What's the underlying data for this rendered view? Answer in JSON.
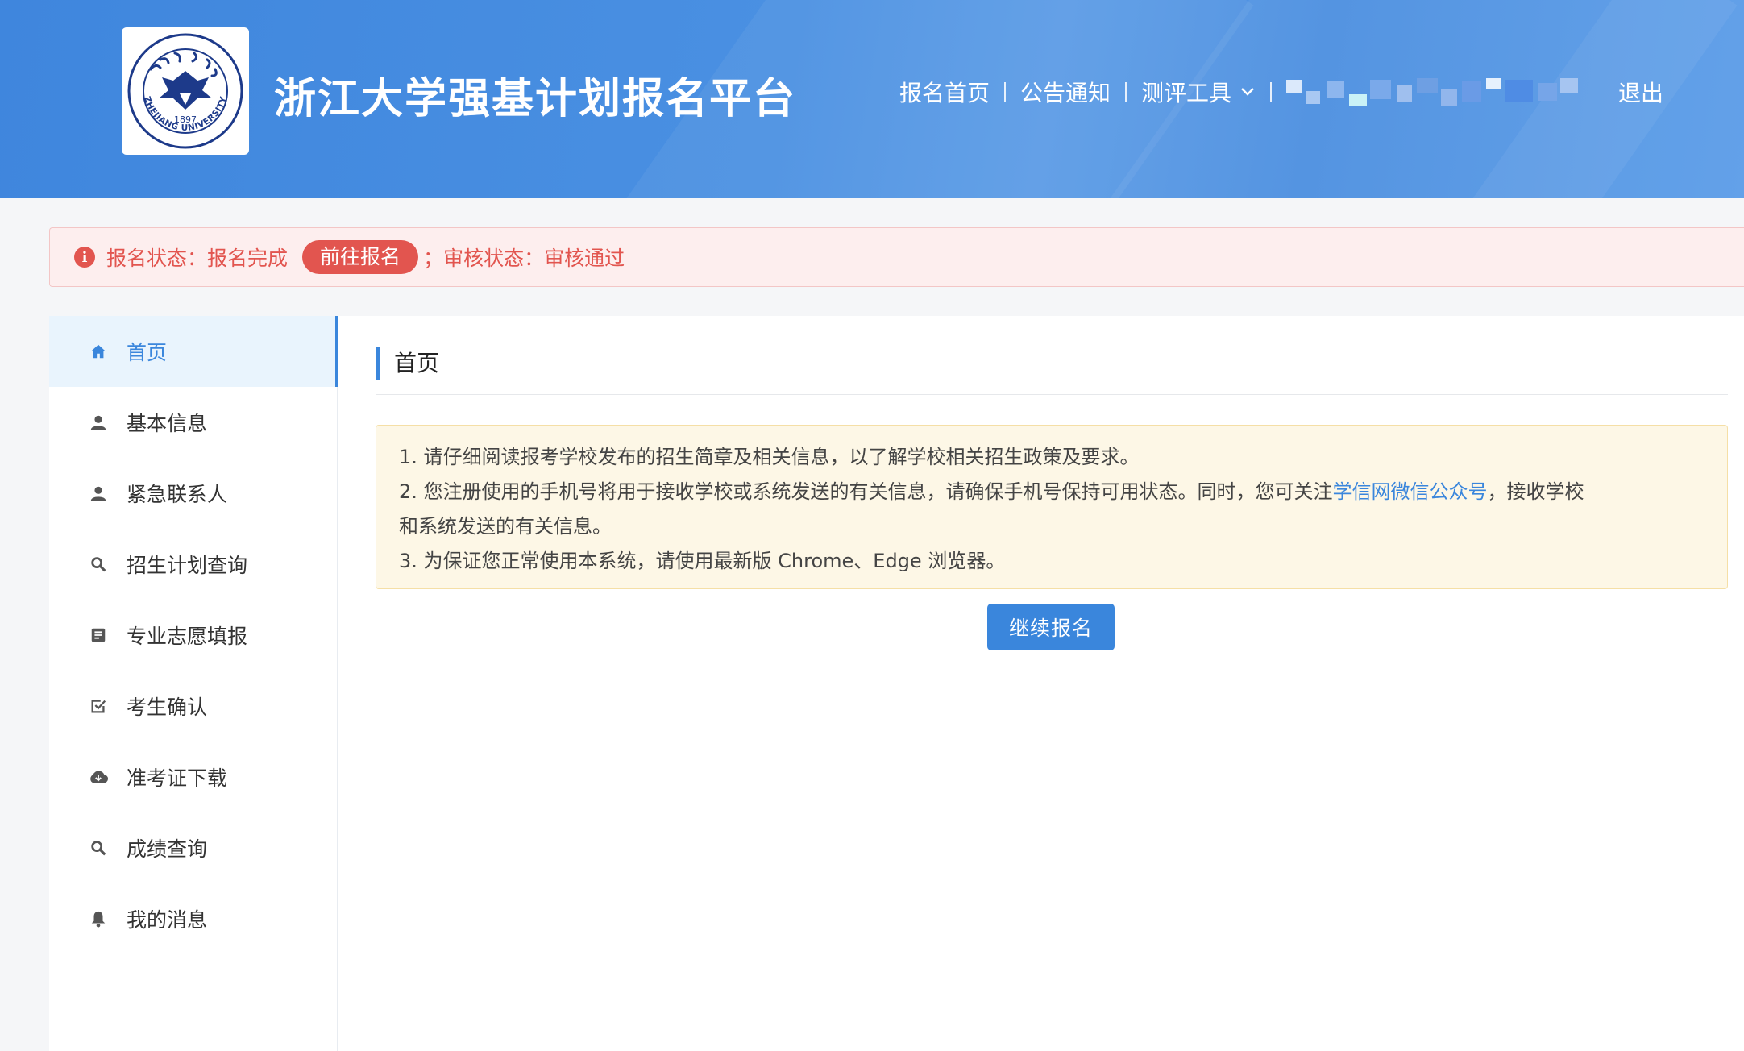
{
  "header": {
    "site_title": "浙江大学强基计划报名平台",
    "logo_alt": "ZHEJIANG UNIVERSITY",
    "logo_year": "1897",
    "nav": [
      {
        "label": "报名首页"
      },
      {
        "label": "公告通知"
      },
      {
        "label": "测评工具"
      }
    ],
    "logout": "退出"
  },
  "status": {
    "reg_label": "报名状态：",
    "reg_value": "报名完成",
    "go_button": "前往报名",
    "separator": "；",
    "audit_label": "审核状态：",
    "audit_value": "审核通过"
  },
  "sidebar": {
    "items": [
      {
        "label": "首页",
        "icon": "home-icon",
        "active": true
      },
      {
        "label": "基本信息",
        "icon": "user-icon"
      },
      {
        "label": "紧急联系人",
        "icon": "user-icon"
      },
      {
        "label": "招生计划查询",
        "icon": "search-icon"
      },
      {
        "label": "专业志愿填报",
        "icon": "document-icon"
      },
      {
        "label": "考生确认",
        "icon": "checkbox-icon"
      },
      {
        "label": "准考证下载",
        "icon": "cloud-download-icon"
      },
      {
        "label": "成绩查询",
        "icon": "search-icon"
      },
      {
        "label": "我的消息",
        "icon": "bell-icon"
      }
    ]
  },
  "main": {
    "title": "首页",
    "notice": {
      "line1": "1. 请仔细阅读报考学校发布的招生简章及相关信息，以了解学校相关招生政策及要求。",
      "line2_pre": "2. 您注册使用的手机号将用于接收学校或系统发送的有关信息，请确保手机号保持可用状态。同时，您可关注",
      "line2_link": "学信网微信公众号",
      "line2_post": "，接收学校",
      "line2_cont": "和系统发送的有关信息。",
      "line3": "3. 为保证您正常使用本系统，请使用最新版 Chrome、Edge 浏览器。"
    },
    "continue_button": "继续报名"
  },
  "colors": {
    "primary": "#3a86dc",
    "header_bg": "#4a90e2",
    "alert_red": "#e2554f",
    "alert_bg": "#fdeeee",
    "notice_bg": "#fdf7e6"
  }
}
